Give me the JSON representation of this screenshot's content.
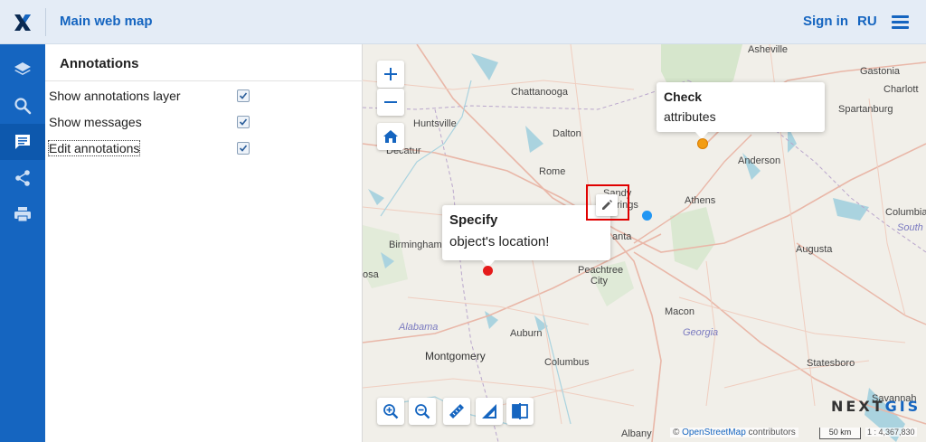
{
  "header": {
    "title": "Main web map",
    "signin": "Sign in",
    "lang": "RU"
  },
  "panel": {
    "title": "Annotations",
    "options": [
      {
        "label": "Show annotations layer",
        "checked": true
      },
      {
        "label": "Show messages",
        "checked": true
      },
      {
        "label": "Edit annotations",
        "checked": true
      }
    ]
  },
  "nav": [
    "layers-icon",
    "search-icon",
    "annotations-icon",
    "share-icon",
    "print-icon"
  ],
  "map": {
    "zoom_in": "+",
    "zoom_out": "−",
    "cities": {
      "asheville": "Asheville",
      "gastonia": "Gastonia",
      "charlotte": "Charlott",
      "chattanooga": "Chattanooga",
      "spartanburg": "Spartanburg",
      "huntsville": "Huntsville",
      "dalton": "Dalton",
      "decatur": "Decatur",
      "anderson": "Anderson",
      "rome": "Rome",
      "sandy": "Sandy",
      "springs": "rings",
      "athens": "Athens",
      "columbia": "Columbia",
      "south": "South",
      "birmingham": "Birmingham",
      "atlanta": "anta",
      "augusta": "Augusta",
      "hoover": "osa",
      "peachtree": "Peachtree",
      "city": "City",
      "macon": "Macon",
      "alabama": "Alabama",
      "georgia": "Georgia",
      "auburn": "Auburn",
      "montgomery": "Montgomery",
      "columbus": "Columbus",
      "statesboro": "Statesboro",
      "savannah": "Savannah",
      "albany": "Albany"
    },
    "popup_check": {
      "title": "Check",
      "body": "attributes"
    },
    "popup_specify": {
      "title": "Specify",
      "body": "object's location!"
    },
    "brand_a": "NEXT",
    "brand_b": "GIS",
    "attribution_prefix": "© ",
    "attribution_link": "OpenStreetMap",
    "attribution_suffix": " contributors",
    "scale": "50 km",
    "scale_ratio": "1 : 4,367,830"
  },
  "colors": {
    "brand": "#1565c0",
    "marker_orange": "#f39c12",
    "marker_blue": "#2196f3",
    "marker_red": "#e51b1b",
    "highlight": "#e00000"
  }
}
